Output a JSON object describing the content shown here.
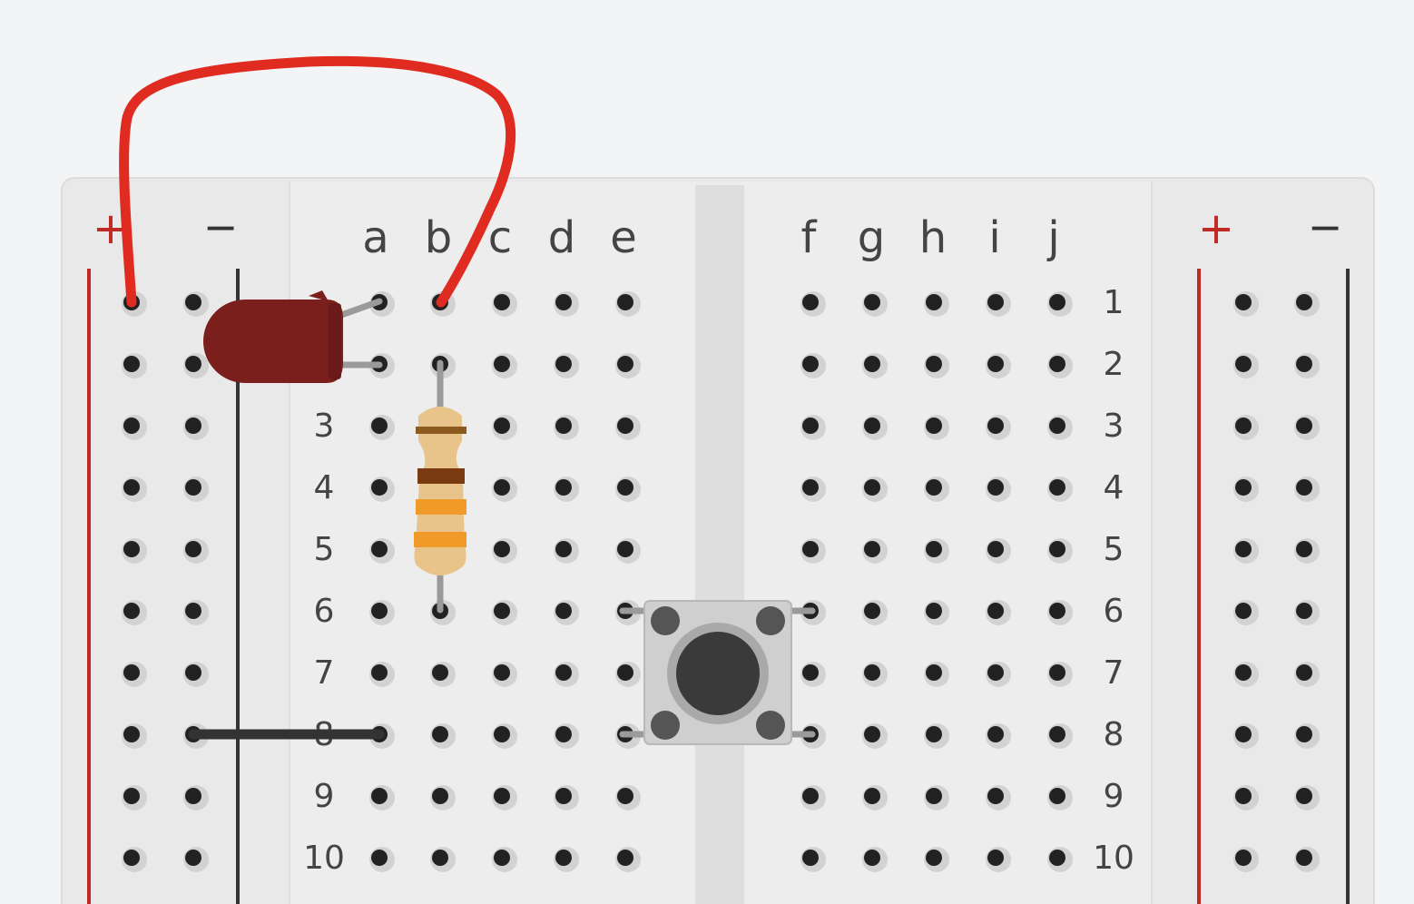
{
  "board": {
    "column_labels_left": [
      "a",
      "b",
      "c",
      "d",
      "e"
    ],
    "column_labels_right": [
      "f",
      "g",
      "h",
      "i",
      "j"
    ],
    "row_labels_left": [
      "3",
      "4",
      "5",
      "6",
      "7",
      "8",
      "9",
      "10"
    ],
    "row_labels_right": [
      "1",
      "2",
      "3",
      "4",
      "5",
      "6",
      "7",
      "8",
      "9",
      "10"
    ],
    "rail_plus": "+",
    "rail_minus": "−",
    "visible_rows": 10
  },
  "components": {
    "led": {
      "color": "#7a1f1c",
      "anode_at": "a1",
      "cathode_at": "a2"
    },
    "resistor": {
      "from": "b2",
      "to": "b6",
      "bands": [
        "#8a5a1e",
        "#7a3a12",
        "#f09a2a",
        "#f09a2a"
      ]
    },
    "pushbutton": {
      "pins": [
        "e6",
        "f6",
        "e8",
        "f8"
      ]
    },
    "red_wire": {
      "from": "left-plus-rail",
      "to": "b1",
      "color": "#e02b20"
    },
    "black_wire": {
      "from": "left-minus-rail",
      "to": "a8",
      "color": "#333333"
    }
  },
  "colors": {
    "background": "#f3f4f6",
    "board": "#e9e9e9",
    "rail_positive": "#c02a25",
    "rail_negative": "#333333",
    "hole": "#222222",
    "label": "#444444"
  }
}
